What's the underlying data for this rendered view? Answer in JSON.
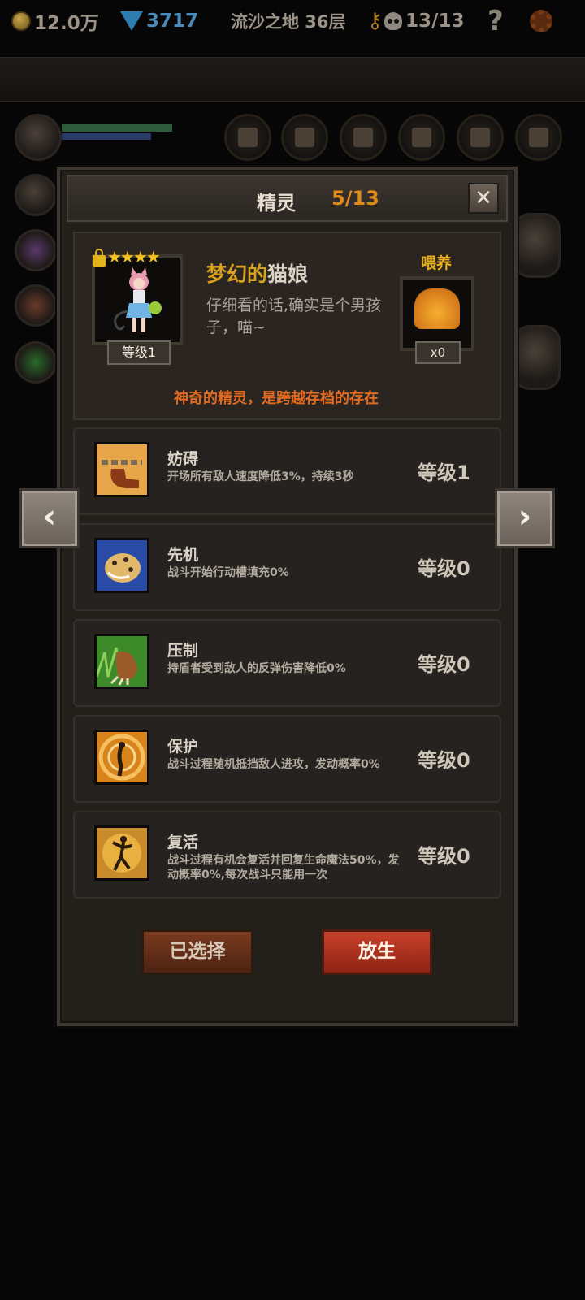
{
  "topbar": {
    "gold": "12.0万",
    "gems": "3717",
    "location": "流沙之地 36层",
    "kills": "13/13",
    "help": "?"
  },
  "panel": {
    "title": "精灵",
    "count": "5/13",
    "close": "✕"
  },
  "sprite": {
    "name_part1": "梦幻的",
    "name_part2": "猫娘",
    "stars": "★★★★",
    "level": "等级1",
    "description": "仔细看的话,确实是个男孩子，喵~",
    "feed_label": "喂养",
    "feed_count": "x0",
    "tagline": "神奇的精灵，是跨越存档的存在"
  },
  "skills": [
    {
      "name": "妨碍",
      "desc": "开场所有敌人速度降低3%，持续3秒",
      "level": "等级1",
      "icon": "shackle-icon"
    },
    {
      "name": "先机",
      "desc": "战斗开始行动槽填充0%",
      "level": "等级0",
      "icon": "leopard-icon"
    },
    {
      "name": "压制",
      "desc": "持盾者受到敌人的反弹伤害降低0%",
      "level": "等级0",
      "icon": "claw-icon"
    },
    {
      "name": "保护",
      "desc": "战斗过程随机抵挡敌人进攻，发动概率0%",
      "level": "等级0",
      "icon": "fairy-icon"
    },
    {
      "name": "复活",
      "desc": "战斗过程有机会复活并回复生命魔法50%，发动概率0%,每次战斗只能用一次",
      "level": "等级0",
      "icon": "revive-icon"
    }
  ],
  "nav": {
    "prev": "‹",
    "next": "›"
  },
  "buttons": {
    "selected": "已选择",
    "release": "放生"
  }
}
